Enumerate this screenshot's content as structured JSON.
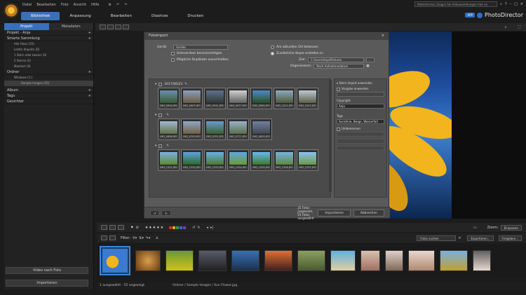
{
  "menu": [
    "Datei",
    "Bearbeiten",
    "Foto",
    "Ansicht",
    "Hilfe"
  ],
  "top_search": "Bildschirmen Zeigen Sie Videoanleitungen hier an",
  "tabs": [
    "Bibliothek",
    "Anpassung",
    "Bearbeiten",
    "Diashow",
    "Drucken"
  ],
  "brand": {
    "app_badge": "APP",
    "name": "PhotoDirector"
  },
  "left_tabs": [
    "Projekt",
    "Metadaten"
  ],
  "project_label": "Projekt - Anja",
  "tree": {
    "smart_collection": "Smarte Sammlung",
    "smart_items": [
      "Alle Fotos (55)",
      "Letzte Importe (0)",
      "1 Stern oder besser (0)",
      "5 Sterne (0)",
      "Markiert (0)"
    ],
    "folders": "Ordner",
    "folder_items": [
      "Windows (C:)",
      "Sample Images (55)"
    ],
    "album": "Album",
    "tags": "Tags",
    "faces": "Gesichter"
  },
  "left_buttons": {
    "video": "Video nach Foto",
    "import": "Importieren"
  },
  "dialog": {
    "title": "Fotoimport",
    "close": "×",
    "device_label": "Gerät:",
    "device_value": "Geräte",
    "opt1": "Unterordner berücksichtigen",
    "opt2": "Mögliche Duplikate ausschließen",
    "radio1": "Am aktuellen Ort belassen",
    "radio2": "Zusätzliche Kopie erstellen in:",
    "target_label": "Ziel:",
    "target_value": "C:\\Users\\Anja\\Pictures",
    "browse": "...",
    "organize_label": "Organisieren:",
    "organize_value": "Nach Aufnahmedatum",
    "groups": [
      {
        "date": "2017/06/23",
        "labels": [
          "IMG_0904.JPG",
          "IMG_0907.JPG",
          "IMG_0911.JPG",
          "IMG_0977.JPG",
          "IMG_0965.JPG",
          "IMG_1011.JPG",
          "IMG_1023.JPG"
        ]
      },
      {
        "date": "",
        "labels": [
          "IMG_0698.JPG",
          "IMG_0700.JPG",
          "IMG_0701.JPG",
          "IMG_0771.JPG",
          "IMG_0805.JPG"
        ]
      },
      {
        "date": "",
        "labels": [
          "IMG_1331.JPG",
          "IMG_1332.JPG",
          "IMG_1333.JPG",
          "IMG_1334.JPG",
          "IMG_1335.JPG",
          "IMG_1336.JPG",
          "IMG_1337.JPG"
        ]
      }
    ],
    "right": {
      "header": "Beim Import anwenden",
      "preset_chk": "Vorgabe anwenden",
      "copyright_label": "Copyright",
      "copyright_value": "Anja",
      "tags_label": "Tags",
      "tags_value": "Sunshine, Berge, Wasserfall",
      "rename_chk": "Umbenennen"
    },
    "footer": {
      "count": "25 Fotos insgesamt, 25 Fotos ausgewählt",
      "import": "Importieren",
      "cancel": "Abbrechen"
    }
  },
  "filmstrip": {
    "zoom_label": "Zoom:",
    "zoom_value": "Einpassen",
    "filter_label": "Filter:",
    "search_placeholder": "Fotos suchen",
    "export": "Exportieren...",
    "share": "Freigeben..."
  },
  "status": {
    "selected": "1 ausgewählt - 55 angezeigt",
    "path": "Ordner / Sample Images / Sun Flower.jpg"
  },
  "colors": {
    "accent": "#3a70b8",
    "selection": "#3a86d8"
  }
}
